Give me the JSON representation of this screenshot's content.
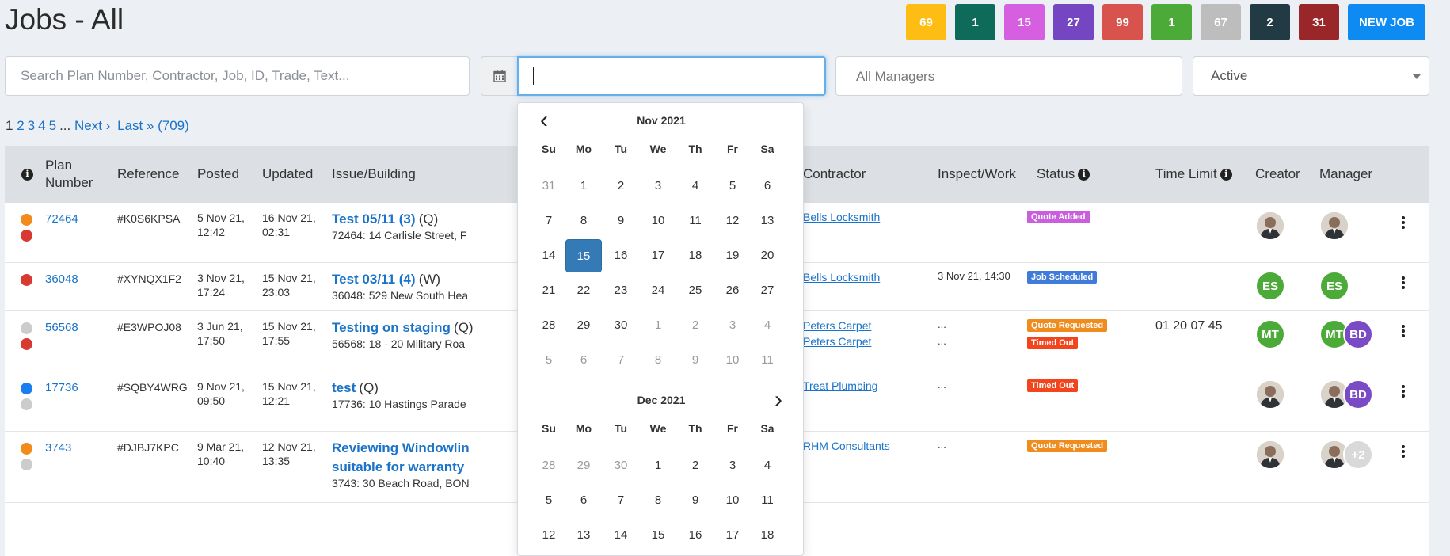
{
  "page_title": "Jobs - All",
  "badges": [
    {
      "count": "69",
      "color": "#fdbd12",
      "text_color": "#ffffff"
    },
    {
      "count": "1",
      "color": "#0e6b5a",
      "text_color": "#ffffff"
    },
    {
      "count": "15",
      "color": "#d65ee0",
      "text_color": "#ffffff"
    },
    {
      "count": "27",
      "color": "#7446c1",
      "text_color": "#ffffff"
    },
    {
      "count": "99",
      "color": "#d8534e",
      "text_color": "#ffffff"
    },
    {
      "count": "1",
      "color": "#4caa39",
      "text_color": "#ffffff"
    },
    {
      "count": "67",
      "color": "#bdbdbd",
      "text_color": "#ffffff"
    },
    {
      "count": "2",
      "color": "#213a44",
      "text_color": "#ffffff"
    },
    {
      "count": "31",
      "color": "#992729",
      "text_color": "#ffffff"
    }
  ],
  "new_job_label": "NEW JOB",
  "filters": {
    "search_placeholder": "Search Plan Number, Contractor, Job, ID, Trade, Text...",
    "date_value": "",
    "managers_placeholder": "All Managers",
    "status_value": "Active"
  },
  "pagination": {
    "current": "1",
    "pages": [
      "2",
      "3",
      "4",
      "5"
    ],
    "ellipsis": "...",
    "next": "Next ›",
    "last": "Last » (709)"
  },
  "table": {
    "headers": {
      "plan_number": "Plan Number",
      "reference": "Reference",
      "posted": "Posted",
      "updated": "Updated",
      "issue_building": "Issue/Building",
      "contractor": "Contractor",
      "inspect_work": "Inspect/Work",
      "status": "Status",
      "time_limit": "Time Limit",
      "creator": "Creator",
      "manager": "Manager"
    },
    "rows": [
      {
        "dots": [
          "#f28a1c",
          "#d83a32"
        ],
        "plan": "72464",
        "reference": "#K0S6KPSA",
        "posted_date": "5 Nov 21,",
        "posted_time": "12:42",
        "updated_date": "16 Nov 21,",
        "updated_time": "02:31",
        "issue_title": "Test 05/11 (3)",
        "issue_type": "(Q)",
        "address": "72464: 14 Carlisle Street, F",
        "contractors": [
          "Bells Locksmith"
        ],
        "inspect": [],
        "statuses": [
          {
            "label": "Quote Added",
            "color": "#c95fdc"
          }
        ],
        "time_limit": "",
        "creator": {
          "type": "photo",
          "initials": ""
        },
        "managers": [
          {
            "type": "photo",
            "initials": ""
          }
        ]
      },
      {
        "dots": [
          "#d83a32"
        ],
        "plan": "36048",
        "reference": "#XYNQX1F2",
        "posted_date": "3 Nov 21,",
        "posted_time": "17:24",
        "updated_date": "15 Nov 21,",
        "updated_time": "23:03",
        "issue_title": "Test 03/11 (4)",
        "issue_type": "(W)",
        "address": "36048: 529 New South Hea",
        "contractors": [
          "Bells Locksmith"
        ],
        "inspect": [
          "3 Nov 21, 14:30"
        ],
        "statuses": [
          {
            "label": "Job Scheduled",
            "color": "#3f7bd8"
          }
        ],
        "time_limit": "",
        "creator": {
          "type": "initials",
          "initials": "ES",
          "color": "#4caa39"
        },
        "managers": [
          {
            "type": "initials",
            "initials": "ES",
            "color": "#4caa39"
          }
        ]
      },
      {
        "dots": [
          "#cccccc",
          "#d83a32"
        ],
        "plan": "56568",
        "reference": "#E3WPOJ08",
        "posted_date": "3 Jun 21,",
        "posted_time": "17:50",
        "updated_date": "15 Nov 21,",
        "updated_time": "17:55",
        "issue_title": "Testing on staging",
        "issue_type": "(Q)",
        "address": "56568: 18 - 20 Military Roa",
        "contractors": [
          "Peters Carpet",
          "Peters Carpet"
        ],
        "inspect": [
          "...",
          "..."
        ],
        "statuses": [
          {
            "label": "Quote Requested",
            "color": "#f08c1e"
          },
          {
            "label": "Timed Out",
            "color": "#f2441d"
          }
        ],
        "time_limit": "01 20 07 45",
        "creator": {
          "type": "initials",
          "initials": "MT",
          "color": "#4caa39"
        },
        "managers": [
          {
            "type": "initials",
            "initials": "MT",
            "color": "#4caa39"
          },
          {
            "type": "initials",
            "initials": "BD",
            "color": "#7a4bc4"
          }
        ]
      },
      {
        "dots": [
          "#1a7ef0",
          "#cccccc"
        ],
        "plan": "17736",
        "reference": "#SQBY4WRG",
        "posted_date": "9 Nov 21,",
        "posted_time": "09:50",
        "updated_date": "15 Nov 21,",
        "updated_time": "12:21",
        "issue_title": "test",
        "issue_type": "(Q)",
        "address": "17736: 10 Hastings Parade",
        "contractors": [
          "Treat Plumbing"
        ],
        "inspect": [
          "..."
        ],
        "statuses": [
          {
            "label": "Timed Out",
            "color": "#f2441d"
          }
        ],
        "time_limit": "",
        "creator": {
          "type": "photo",
          "initials": ""
        },
        "managers": [
          {
            "type": "photo",
            "initials": ""
          },
          {
            "type": "initials",
            "initials": "BD",
            "color": "#7a4bc4"
          }
        ]
      },
      {
        "dots": [
          "#f28a1c",
          "#cccccc"
        ],
        "plan": "3743",
        "reference": "#DJBJ7KPC",
        "posted_date": "9 Mar 21,",
        "posted_time": "10:40",
        "updated_date": "12 Nov 21,",
        "updated_time": "13:35",
        "issue_title": "Reviewing Windowlin",
        "issue_title_2": "suitable for warranty",
        "issue_type": "",
        "address": "3743: 30 Beach Road, BON",
        "contractors": [
          "RHM Consultants"
        ],
        "inspect": [
          "..."
        ],
        "statuses": [
          {
            "label": "Quote Requested",
            "color": "#f08c1e"
          }
        ],
        "time_limit": "",
        "creator": {
          "type": "photo",
          "initials": ""
        },
        "managers": [
          {
            "type": "photo",
            "initials": ""
          },
          {
            "type": "initials",
            "initials": "+2",
            "color": "#d9d9d9"
          }
        ]
      }
    ]
  },
  "datepicker": {
    "weekdays": [
      "Su",
      "Mo",
      "Tu",
      "We",
      "Th",
      "Fr",
      "Sa"
    ],
    "months": [
      {
        "label": "Nov 2021",
        "weeks": [
          [
            [
              "31",
              1
            ],
            [
              "1",
              0
            ],
            [
              "2",
              0
            ],
            [
              "3",
              0
            ],
            [
              "4",
              0
            ],
            [
              "5",
              0
            ],
            [
              "6",
              0
            ]
          ],
          [
            [
              "7",
              0
            ],
            [
              "8",
              0
            ],
            [
              "9",
              0
            ],
            [
              "10",
              0
            ],
            [
              "11",
              0
            ],
            [
              "12",
              0
            ],
            [
              "13",
              0
            ]
          ],
          [
            [
              "14",
              0
            ],
            [
              "15",
              2
            ],
            [
              "16",
              0
            ],
            [
              "17",
              0
            ],
            [
              "18",
              0
            ],
            [
              "19",
              0
            ],
            [
              "20",
              0
            ]
          ],
          [
            [
              "21",
              0
            ],
            [
              "22",
              0
            ],
            [
              "23",
              0
            ],
            [
              "24",
              0
            ],
            [
              "25",
              0
            ],
            [
              "26",
              0
            ],
            [
              "27",
              0
            ]
          ],
          [
            [
              "28",
              0
            ],
            [
              "29",
              0
            ],
            [
              "30",
              0
            ],
            [
              "1",
              1
            ],
            [
              "2",
              1
            ],
            [
              "3",
              1
            ],
            [
              "4",
              1
            ]
          ],
          [
            [
              "5",
              1
            ],
            [
              "6",
              1
            ],
            [
              "7",
              1
            ],
            [
              "8",
              1
            ],
            [
              "9",
              1
            ],
            [
              "10",
              1
            ],
            [
              "11",
              1
            ]
          ]
        ]
      },
      {
        "label": "Dec 2021",
        "weeks": [
          [
            [
              "28",
              1
            ],
            [
              "29",
              1
            ],
            [
              "30",
              1
            ],
            [
              "1",
              0
            ],
            [
              "2",
              0
            ],
            [
              "3",
              0
            ],
            [
              "4",
              0
            ]
          ],
          [
            [
              "5",
              0
            ],
            [
              "6",
              0
            ],
            [
              "7",
              0
            ],
            [
              "8",
              0
            ],
            [
              "9",
              0
            ],
            [
              "10",
              0
            ],
            [
              "11",
              0
            ]
          ],
          [
            [
              "12",
              0
            ],
            [
              "13",
              0
            ],
            [
              "14",
              0
            ],
            [
              "15",
              0
            ],
            [
              "16",
              0
            ],
            [
              "17",
              0
            ],
            [
              "18",
              0
            ]
          ]
        ]
      }
    ]
  }
}
